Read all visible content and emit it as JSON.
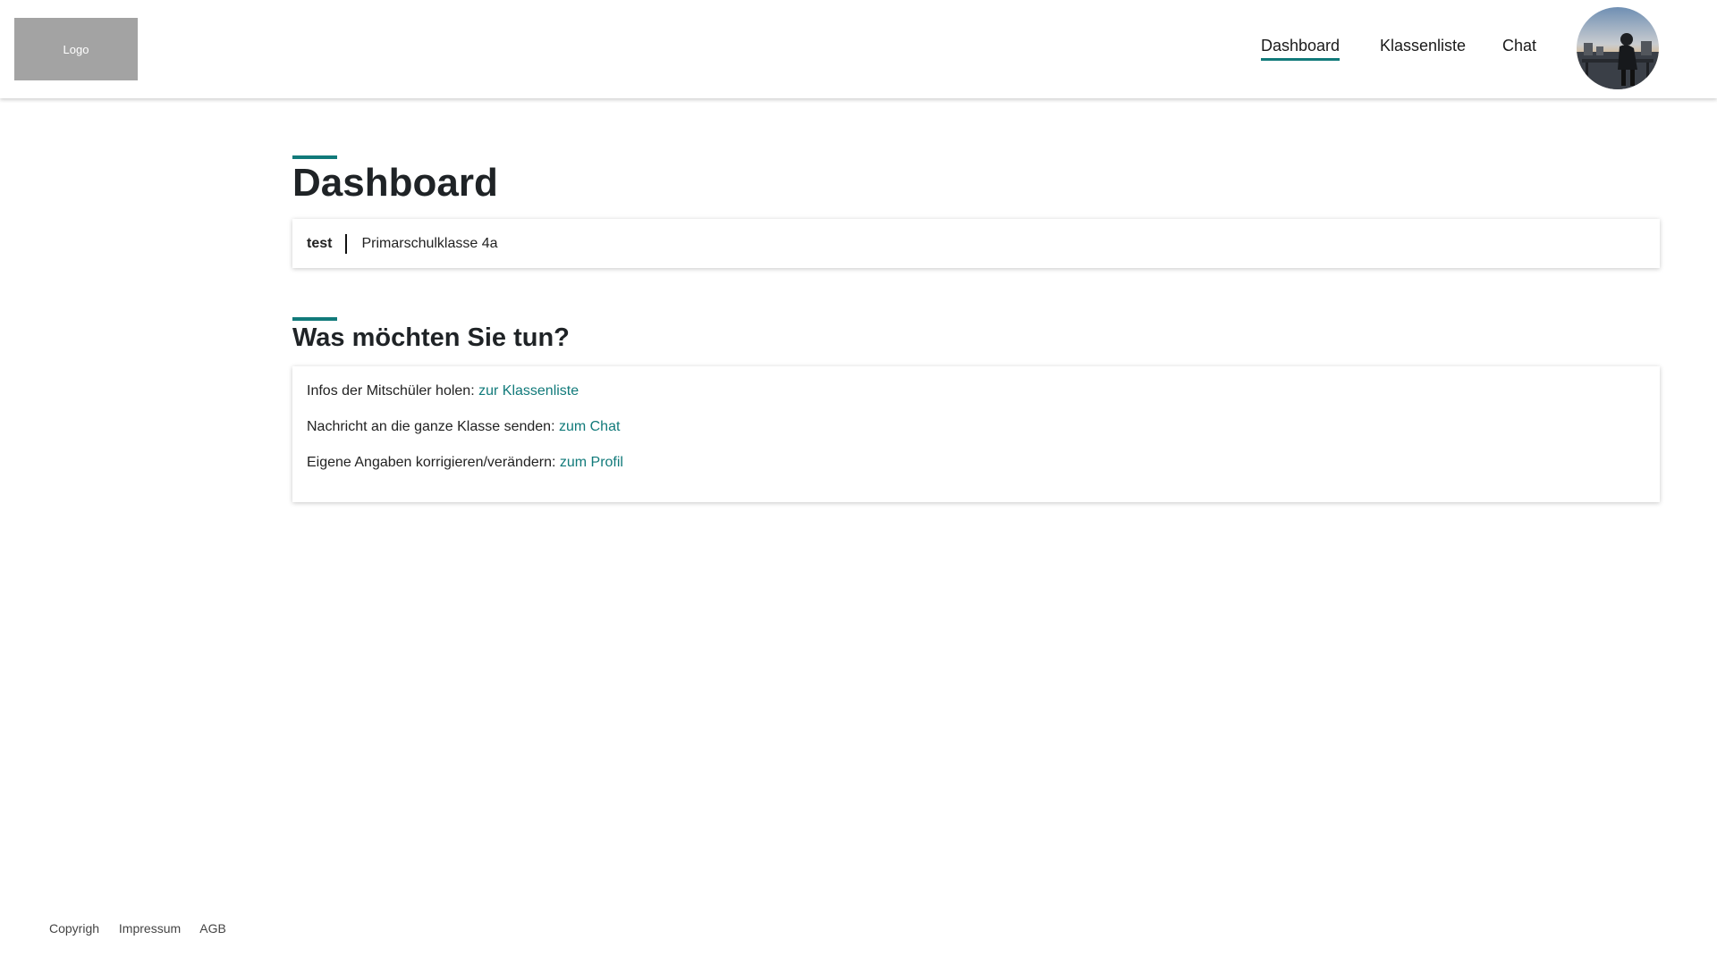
{
  "header": {
    "logo_label": "Logo",
    "nav": [
      {
        "label": "Dashboard",
        "active": true
      },
      {
        "label": "Klassenliste",
        "active": false
      },
      {
        "label": "Chat",
        "active": false
      }
    ]
  },
  "main": {
    "title": "Dashboard",
    "info": {
      "user": "test",
      "class": "Primarschulklasse 4a"
    },
    "section_title": "Was möchten Sie tun?",
    "actions": [
      {
        "text": "Infos der Mitschüler holen: ",
        "link": "zur Klassenliste"
      },
      {
        "text": "Nachricht an die ganze Klasse senden: ",
        "link": "zum Chat"
      },
      {
        "text": "Eigene Angaben korrigieren/verändern: ",
        "link": "zum Profil"
      }
    ]
  },
  "footer": {
    "links": [
      "Copyrigh",
      "Impressum",
      "AGB"
    ]
  },
  "colors": {
    "accent": "#117a7a",
    "logo_bg": "#a3a3a3"
  }
}
